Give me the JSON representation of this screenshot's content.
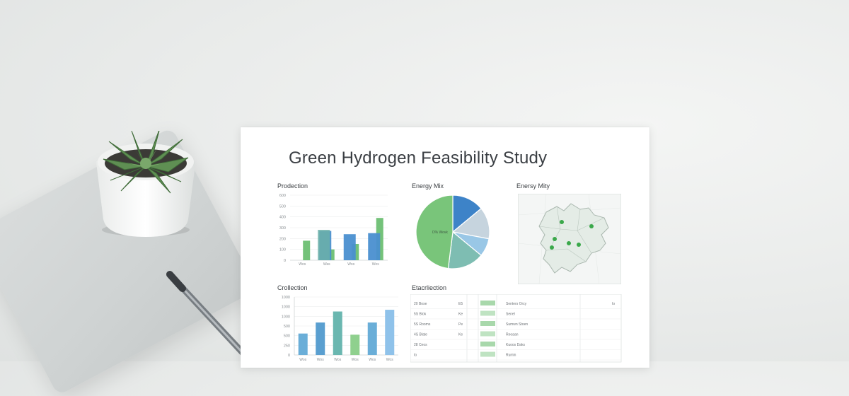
{
  "document": {
    "title": "Green Hydrogen Feasibility Study",
    "panels": {
      "production_label": "Prodection",
      "energy_mix_label": "Energy Mix",
      "map_label": "Enersy Mity",
      "collection_label": "Crollection",
      "table_label": "Etacrliection"
    }
  },
  "chart_data": [
    {
      "type": "bar",
      "title": "Prodection",
      "y_ticks": [
        "600",
        "500",
        "400",
        "300",
        "200",
        "100",
        "0"
      ],
      "categories": [
        "Wos",
        "Was",
        "Wos",
        "Wos"
      ],
      "series": [
        {
          "color": "#6dbf73",
          "values": [
            180,
            100,
            150,
            390
          ]
        },
        {
          "color": "#4a8fd0",
          "values": [
            0,
            270,
            240,
            250
          ]
        },
        {
          "color": "#6bb0a8",
          "values": [
            0,
            280,
            0,
            0
          ]
        }
      ],
      "ylim": [
        0,
        600
      ]
    },
    {
      "type": "pie",
      "title": "Energy Mix",
      "inner_label": "D% Wovk",
      "slices": [
        {
          "value": 14,
          "color": "#3d83c8"
        },
        {
          "value": 14,
          "color": "#c6d4de"
        },
        {
          "value": 8,
          "color": "#99c7e6"
        },
        {
          "value": 16,
          "color": "#7ebdb2"
        },
        {
          "value": 48,
          "color": "#79c57a"
        }
      ]
    },
    {
      "type": "bar",
      "title": "Crollection",
      "y_ticks": [
        "1000",
        "1000",
        "1000",
        "500",
        "500",
        "250",
        "0"
      ],
      "categories": [
        "Wos",
        "Wos",
        "Wos",
        "Wos",
        "Wos",
        "Wos"
      ],
      "values": [
        370,
        560,
        750,
        350,
        560,
        780
      ],
      "colors": [
        "#6aaed8",
        "#5a9fd0",
        "#6ab7b0",
        "#8fd08e",
        "#6aaed8",
        "#8fc2ea"
      ],
      "ylim": [
        0,
        1000
      ]
    }
  ],
  "map": {
    "points": 6,
    "color": "#3aa84a"
  },
  "table": {
    "rows": [
      {
        "c1": "20 Bose",
        "c2": "E5",
        "c3": "",
        "c4": "Senters Orcy",
        "c5": "Io"
      },
      {
        "c1": "5S Blok",
        "c2": "Ke",
        "c3": "",
        "c4": "Senel",
        "c5": ""
      },
      {
        "c1": "5S Rooms",
        "c2": "Pe",
        "c3": "",
        "c4": "Sumwn Stoen",
        "c5": ""
      },
      {
        "c1": "4S Blate",
        "c2": "Ke",
        "c3": "",
        "c4": "Reoaan",
        "c5": ""
      },
      {
        "c1": "28 Ceos",
        "c2": "",
        "c3": "",
        "c4": "Kuoos Daks",
        "c5": ""
      },
      {
        "c1": "Io",
        "c2": "",
        "c3": "",
        "c4": "Rumin",
        "c5": ""
      }
    ]
  },
  "colors": {
    "green": "#79c57a",
    "blue": "#3d83c8",
    "teal": "#7ebdb2"
  }
}
